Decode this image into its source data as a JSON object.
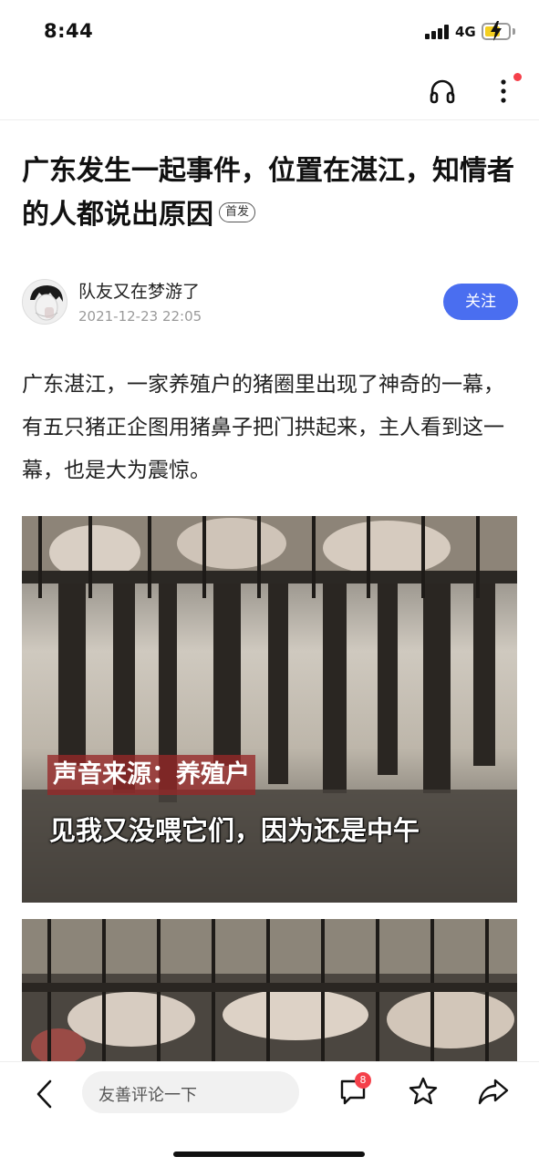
{
  "status_bar": {
    "time": "8:44",
    "network": "4G",
    "battery_color": "#f4cf20"
  },
  "top_nav": {
    "icons": [
      "headphones-icon",
      "more-icon"
    ],
    "notification_dot_color": "#f5404a"
  },
  "article": {
    "title": "广东发生一起事件，位置在湛江，知情者的人都说出原因",
    "badge": "首发",
    "author": {
      "name": "队友又在梦游了",
      "time": "2021-12-23 22:05",
      "follow_label": "关注"
    },
    "body": "广东湛江，一家养殖户的猪圈里出现了神奇的一幕，有五只猪正企图用猪鼻子把门拱起来，主人看到这一幕，也是大为震惊。",
    "image_1": {
      "caption_source": "声音来源：养殖户",
      "caption_line": "见我又没喂它们，因为还是中午"
    }
  },
  "bottom_bar": {
    "comment_placeholder": "友善评论一下",
    "comment_count": "8",
    "accent_color": "#4a6ef0"
  }
}
